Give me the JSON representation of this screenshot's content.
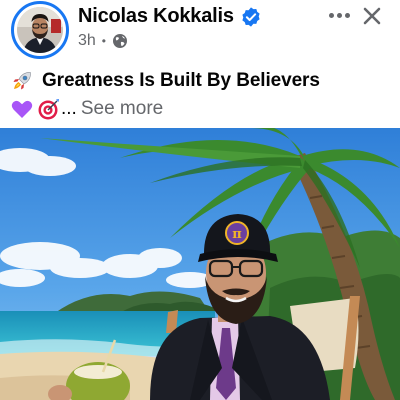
{
  "post": {
    "author_name": "Nicolas Kokkalis",
    "time": "3h",
    "separator": "•",
    "caption_title": "Greatness Is Built By Believers",
    "ellipsis": "...",
    "see_more": "See more"
  },
  "icons": {
    "verified": "verified-badge-icon",
    "audience": "globe-icon",
    "more": "more-options-icon",
    "close": "close-icon",
    "rocket": "rocket-emoji",
    "heart": "purple-heart-emoji",
    "target": "target-emoji"
  },
  "colors": {
    "accent": "#1877f2",
    "text": "#050505",
    "secondary": "#65676b",
    "pi_badge": "#6b3fa0",
    "pi_symbol": "#f0b429"
  },
  "photo": {
    "hat_logo": "π"
  }
}
